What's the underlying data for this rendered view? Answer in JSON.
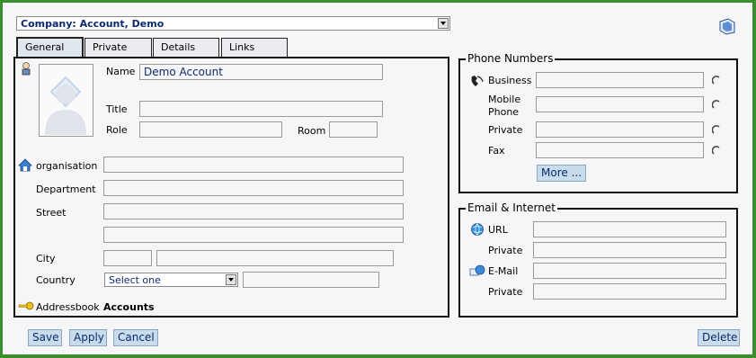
{
  "company_select": {
    "value": "Company: Account, Demo"
  },
  "tabs": [
    {
      "label": "General"
    },
    {
      "label": "Private"
    },
    {
      "label": "Details"
    },
    {
      "label": "Links"
    }
  ],
  "general": {
    "name_label": "Name",
    "name_value": "Demo Account",
    "title_label": "Title",
    "role_label": "Role",
    "room_label": "Room",
    "organisation_label": "organisation",
    "department_label": "Department",
    "street_label": "Street",
    "city_label": "City",
    "country_label": "Country",
    "country_value": "Select one",
    "addressbook_label": "Addressbook",
    "addressbook_value": "Accounts"
  },
  "phone": {
    "legend": "Phone Numbers",
    "business_label": "Business",
    "mobile_label_1": "Mobile",
    "mobile_label_2": "Phone",
    "private_label": "Private",
    "fax_label": "Fax",
    "more_label": "More ..."
  },
  "email": {
    "legend": "Email & Internet",
    "url_label": "URL",
    "url_private_label": "Private",
    "email_label": "E-Mail",
    "email_private_label": "Private"
  },
  "buttons": {
    "save": "Save",
    "apply": "Apply",
    "cancel": "Cancel",
    "delete": "Delete"
  },
  "colors": {
    "border_green": "#3c8c30",
    "button_bg": "#c9dcec",
    "text_blue": "#0b2a6e"
  }
}
